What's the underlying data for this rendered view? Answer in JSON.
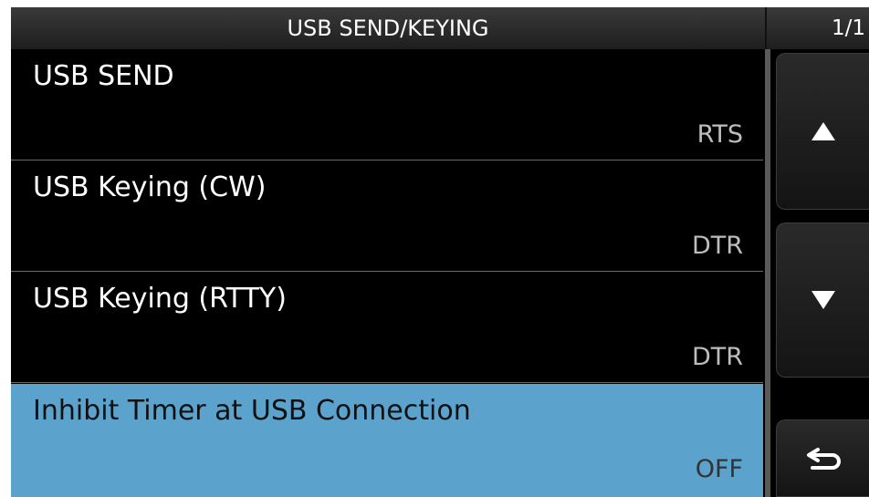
{
  "header": {
    "title": "USB SEND/KEYING",
    "page": "1/1"
  },
  "items": [
    {
      "label": "USB SEND",
      "value": "RTS"
    },
    {
      "label": "USB Keying (CW)",
      "value": "DTR"
    },
    {
      "label": "USB Keying (RTTY)",
      "value": "DTR"
    },
    {
      "label": "Inhibit Timer at USB Connection",
      "value": "OFF"
    }
  ],
  "selected_index": 3,
  "buttons": {
    "up_icon": "triangle-up-icon",
    "down_icon": "triangle-down-icon",
    "back_icon": "return-arrow-icon"
  },
  "colors": {
    "background": "#000000",
    "selected_row": "#5ba3cc",
    "text": "#ffffff",
    "value_text": "#bdbdbd"
  }
}
